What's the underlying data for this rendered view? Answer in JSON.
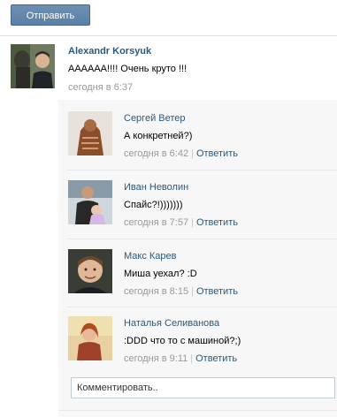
{
  "send_button": "Отправить",
  "post": {
    "author": "Alexandr Korsyuk",
    "text": "АААААА!!!! Очень круто !!!",
    "time": "сегодня в 6:37"
  },
  "replies": [
    {
      "name": "Сергей Ветер",
      "text": "А конкретней?)",
      "time": "сегодня в 6:42",
      "reply": "Ответить"
    },
    {
      "name": "Иван Неволин",
      "text": "Спайс?!)))))))",
      "time": "сегодня в 7:57",
      "reply": "Ответить"
    },
    {
      "name": "Макс Карев",
      "text": "Миша уехал? :D",
      "time": "сегодня в 8:15",
      "reply": "Ответить"
    },
    {
      "name": "Наталья Селиванова",
      "text": ":DDD что то с машиной?;)",
      "time": "сегодня в 9:11",
      "reply": "Ответить"
    }
  ],
  "comment_input": {
    "placeholder": "Комментировать.."
  }
}
